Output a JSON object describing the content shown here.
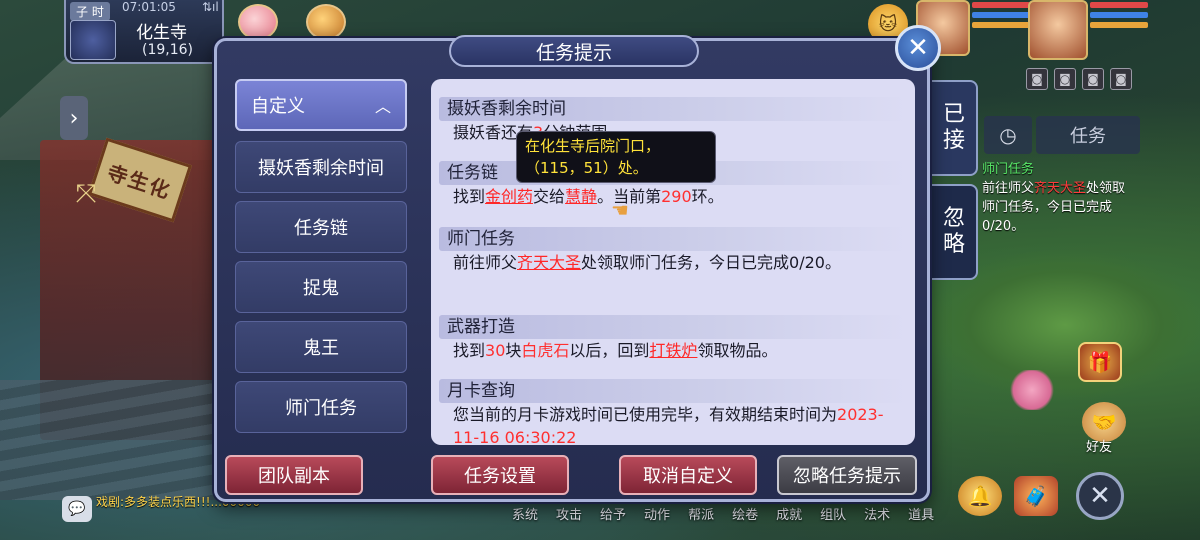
{
  "hud": {
    "time_tag": "子 时",
    "clock": "07:01:05",
    "signal": "⇅ıl",
    "map_name": "化生寺",
    "coords": "(19,16)",
    "temple_sign": "寺生化"
  },
  "dialog": {
    "title": "任务提示",
    "close": "✕",
    "sidebar": [
      {
        "label": "自定义",
        "selected": true
      },
      {
        "label": "摄妖香剩余时间"
      },
      {
        "label": "任务链"
      },
      {
        "label": "捉鬼"
      },
      {
        "label": "鬼王"
      },
      {
        "label": "师门任务"
      }
    ],
    "sections": {
      "s1": {
        "title": "摄妖香剩余时间",
        "text_a": "摄妖香还有",
        "text_b": "分钟范围"
      },
      "s2": {
        "title": "任务链",
        "pre": "找到",
        "item": "金创药",
        "mid": "交给",
        "npc": "慧静",
        "post1": "。当前第",
        "num": "290",
        "post2": "环。"
      },
      "s3": {
        "title": "师门任务",
        "pre": "前往师父",
        "npc": "齐天大圣",
        "post": "处领取师门任务，今日已完成0/20。"
      },
      "s4": {
        "title": "武器打造",
        "pre": "找到",
        "num": "30",
        "mid1": "块",
        "item": "白虎石",
        "mid2": "以后，回到",
        "place": "打铁炉",
        "post": "领取物品。"
      },
      "s5": {
        "title": "月卡查询",
        "text": "您当前的月卡游戏时间已使用完毕，有效期结束时间为",
        "date": "2023-11-16 06:30:22"
      }
    },
    "tooltip": "在化生寺后院门口，（115，51）处。",
    "buttons": {
      "team": "团队副本",
      "settings": "任务设置",
      "cancel_custom": "取消自定义",
      "ignore": "忽略任务提示"
    }
  },
  "tracker": {
    "tab_accepted": "已\n接",
    "tab_ignored": "忽\n略",
    "tasks_label": "任务",
    "title": "师门任务",
    "pre": "前往师父",
    "npc": "齐天大圣",
    "post": "处领取师门任务，今日已完成0/20。"
  },
  "bottom": {
    "chat": "戏剧:多多装点乐西!!!...00000",
    "menu": [
      "系统",
      "攻击",
      "给予",
      "动作",
      "帮派",
      "绘卷",
      "成就",
      "组队",
      "法术",
      "道具"
    ],
    "friend": "好友"
  },
  "colors": {
    "accent_red": "#ff2828",
    "tooltip_yellow": "#ffe23a",
    "tracker_green": "#58e868"
  }
}
